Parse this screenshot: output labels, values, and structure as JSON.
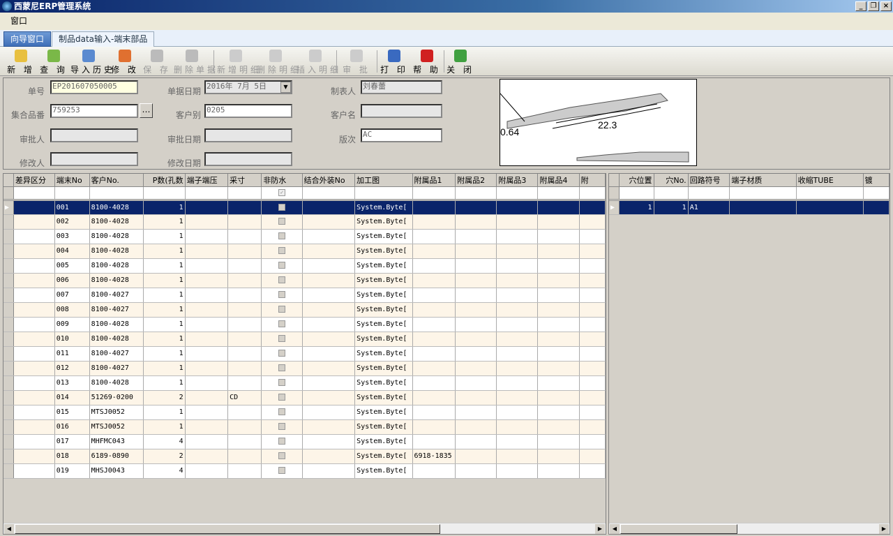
{
  "window": {
    "title": "西蒙尼ERP管理系统",
    "buttons": [
      "_",
      "❐",
      "×"
    ]
  },
  "menu": {
    "items": [
      "窗口"
    ]
  },
  "tabs": [
    {
      "label": "向导窗口"
    },
    {
      "label": "制品data输入-端末部品"
    }
  ],
  "toolbar": [
    {
      "label": "新 增",
      "icon": "new-icon",
      "color": "#e8c040",
      "enabled": true
    },
    {
      "label": "查 询",
      "icon": "query-icon",
      "color": "#7ab848",
      "enabled": true
    },
    {
      "label": "导入历史",
      "icon": "search-icon",
      "color": "#5a8ad0",
      "enabled": true
    },
    {
      "label": "修 改",
      "icon": "edit-icon",
      "color": "#e07030",
      "enabled": true
    },
    {
      "label": "保 存",
      "icon": "save-icon",
      "color": "#bbb",
      "enabled": false
    },
    {
      "label": "删除单据",
      "icon": "delete-icon",
      "color": "#bbb",
      "enabled": false
    },
    {
      "label": "新增明细",
      "icon": "add-detail-icon",
      "color": "#ccc",
      "enabled": false
    },
    {
      "label": "删除明细",
      "icon": "delete-detail-icon",
      "color": "#ccc",
      "enabled": false
    },
    {
      "label": "插入明细",
      "icon": "insert-detail-icon",
      "color": "#ccc",
      "enabled": false
    },
    {
      "label": "审 批",
      "icon": "approve-icon",
      "color": "#ccc",
      "enabled": false
    },
    {
      "label": "打 印",
      "icon": "print-icon",
      "color": "#3a6ac0",
      "enabled": true
    },
    {
      "label": "帮 助",
      "icon": "help-icon",
      "color": "#d02020",
      "enabled": true
    },
    {
      "label": "关 闭",
      "icon": "close-icon",
      "color": "#40a040",
      "enabled": true
    }
  ],
  "form": {
    "order_no": {
      "label": "单号",
      "value": "EP201607050005"
    },
    "order_date": {
      "label": "单据日期",
      "value": "2016年 7月 5日"
    },
    "creator": {
      "label": "制表人",
      "value": "刘春蕾"
    },
    "set_part": {
      "label": "集合品番",
      "value": "759253"
    },
    "customer_code": {
      "label": "客户别",
      "value": "0205"
    },
    "customer_name": {
      "label": "客户名",
      "value": ""
    },
    "approver": {
      "label": "审批人",
      "value": ""
    },
    "approve_date": {
      "label": "审批日期",
      "value": ""
    },
    "version": {
      "label": "版次",
      "value": "AC"
    },
    "modifier": {
      "label": "修改人",
      "value": ""
    },
    "modify_date": {
      "label": "修改日期",
      "value": ""
    },
    "drawing_dims": [
      "0.64",
      "22.3"
    ]
  },
  "left_grid": {
    "columns": [
      "差异区分",
      "端末No",
      "客户No.",
      "P数(孔数",
      "端子端压",
      "采寸",
      "非防水",
      "结合外装No",
      "加工图",
      "附属品1",
      "附属品2",
      "附属品3",
      "附属品4",
      "附"
    ],
    "rows": [
      [
        "",
        "001",
        "8100-4028",
        "1",
        "",
        "",
        "",
        "",
        "System.Byte[",
        "",
        "",
        "",
        "",
        ""
      ],
      [
        "",
        "002",
        "8100-4028",
        "1",
        "",
        "",
        "",
        "",
        "System.Byte[",
        "",
        "",
        "",
        "",
        ""
      ],
      [
        "",
        "003",
        "8100-4028",
        "1",
        "",
        "",
        "",
        "",
        "System.Byte[",
        "",
        "",
        "",
        "",
        ""
      ],
      [
        "",
        "004",
        "8100-4028",
        "1",
        "",
        "",
        "",
        "",
        "System.Byte[",
        "",
        "",
        "",
        "",
        ""
      ],
      [
        "",
        "005",
        "8100-4028",
        "1",
        "",
        "",
        "",
        "",
        "System.Byte[",
        "",
        "",
        "",
        "",
        ""
      ],
      [
        "",
        "006",
        "8100-4028",
        "1",
        "",
        "",
        "",
        "",
        "System.Byte[",
        "",
        "",
        "",
        "",
        ""
      ],
      [
        "",
        "007",
        "8100-4027",
        "1",
        "",
        "",
        "",
        "",
        "System.Byte[",
        "",
        "",
        "",
        "",
        ""
      ],
      [
        "",
        "008",
        "8100-4027",
        "1",
        "",
        "",
        "",
        "",
        "System.Byte[",
        "",
        "",
        "",
        "",
        ""
      ],
      [
        "",
        "009",
        "8100-4028",
        "1",
        "",
        "",
        "",
        "",
        "System.Byte[",
        "",
        "",
        "",
        "",
        ""
      ],
      [
        "",
        "010",
        "8100-4028",
        "1",
        "",
        "",
        "",
        "",
        "System.Byte[",
        "",
        "",
        "",
        "",
        ""
      ],
      [
        "",
        "011",
        "8100-4027",
        "1",
        "",
        "",
        "",
        "",
        "System.Byte[",
        "",
        "",
        "",
        "",
        ""
      ],
      [
        "",
        "012",
        "8100-4027",
        "1",
        "",
        "",
        "",
        "",
        "System.Byte[",
        "",
        "",
        "",
        "",
        ""
      ],
      [
        "",
        "013",
        "8100-4028",
        "1",
        "",
        "",
        "",
        "",
        "System.Byte[",
        "",
        "",
        "",
        "",
        ""
      ],
      [
        "",
        "014",
        "51269-0200",
        "2",
        "",
        "CD",
        "",
        "",
        "System.Byte[",
        "",
        "",
        "",
        "",
        ""
      ],
      [
        "",
        "015",
        "MTSJ0052",
        "1",
        "",
        "",
        "",
        "",
        "System.Byte[",
        "",
        "",
        "",
        "",
        ""
      ],
      [
        "",
        "016",
        "MTSJ0052",
        "1",
        "",
        "",
        "",
        "",
        "System.Byte[",
        "",
        "",
        "",
        "",
        ""
      ],
      [
        "",
        "017",
        "MHFMC043",
        "4",
        "",
        "",
        "",
        "",
        "System.Byte[",
        "",
        "",
        "",
        "",
        ""
      ],
      [
        "",
        "018",
        "6189-0890",
        "2",
        "",
        "",
        "",
        "",
        "System.Byte[",
        "6918-1835",
        "",
        "",
        "",
        ""
      ],
      [
        "",
        "019",
        "MHSJ0043",
        "4",
        "",
        "",
        "",
        "",
        "System.Byte[",
        "",
        "",
        "",
        "",
        ""
      ]
    ]
  },
  "right_grid": {
    "columns": [
      "穴位置",
      "穴No.",
      "回路符号",
      "端子材质",
      "收缩TUBE",
      "镀"
    ],
    "rows": [
      [
        "1",
        "1",
        "A1",
        "",
        "",
        ""
      ]
    ]
  }
}
